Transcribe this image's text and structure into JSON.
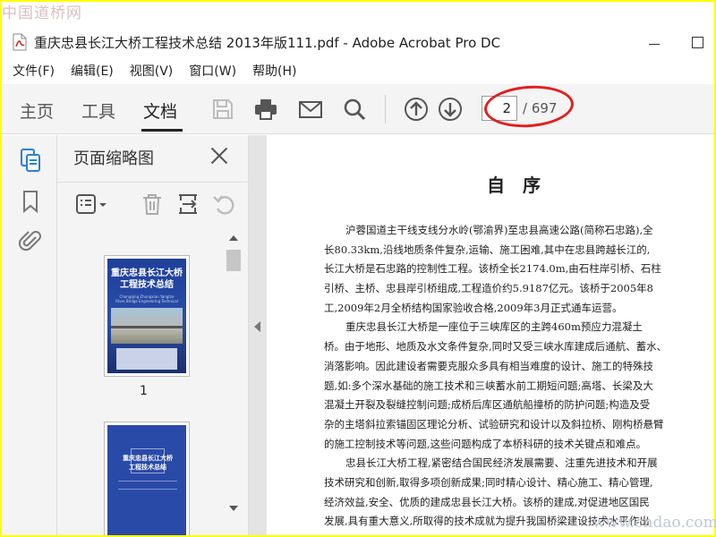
{
  "watermark": {
    "top_left": "中国道桥网",
    "bottom_right": "www.cndao.com"
  },
  "window": {
    "title": "重庆忠县长江大桥工程技术总结 2013年版111.pdf - Adobe Acrobat Pro DC"
  },
  "menu": [
    "文件(F)",
    "编辑(E)",
    "视图(V)",
    "窗口(W)",
    "帮助(H)"
  ],
  "toolbar": {
    "tabs": {
      "home": "主页",
      "tools": "工具",
      "document": "文档"
    },
    "active_tab": "文档",
    "icons": [
      "save-icon",
      "print-icon",
      "email-icon",
      "search-icon",
      "previous-page-icon",
      "next-page-icon"
    ],
    "page_current": "2",
    "page_total": "/ 697",
    "highlight_color": "#e02020"
  },
  "left_rail": {
    "icons": [
      "page-thumbnails-icon",
      "bookmark-icon",
      "attachment-icon"
    ]
  },
  "thumbnail_panel": {
    "title": "页面缩略图",
    "tools": [
      "options-menu-icon",
      "delete-page-icon",
      "extract-page-icon",
      "undo-icon"
    ],
    "thumbnails": [
      {
        "label": "1",
        "cover_title": "重庆忠县长江大桥\n工程技术总结",
        "cover_subtitle": "Chongqing Zhongxian Yangtze River Bridge Engineering Technical Summary"
      },
      {
        "label": "",
        "cover_title": "重庆忠县长江大桥\n工程技术总结"
      }
    ]
  },
  "document": {
    "heading": "自序",
    "lines": [
      {
        "text": "沪蓉国道主干线支线分水岭(鄂渝界)至忠县高速公路(简称石忠路),全",
        "indent": true
      },
      {
        "text": "长80.33km,沿线地质条件复杂,运输、施工困难,其中在忠县跨越长江的,",
        "indent": false
      },
      {
        "text": "长江大桥是石忠路的控制性工程。该桥全长2174.0m,由石柱岸引桥、石柱",
        "indent": false
      },
      {
        "text": "引桥、主桥、忠县岸引桥组成,工程造价约5.9187亿元。该桥于2005年8",
        "indent": false
      },
      {
        "text": "工,2009年2月全桥结构国家验收合格,2009年3月正式通车运营。",
        "indent": false
      },
      {
        "text": "重庆忠县长江大桥是一座位于三峡库区的主跨460m预应力混凝土",
        "indent": true
      },
      {
        "text": "桥。由于地形、地质及水文条件复杂,同时又受三峡水库建成后通航、蓄水、",
        "indent": false
      },
      {
        "text": "消落影响。因此建设者需要克服众多具有相当难度的设计、施工的特殊技",
        "indent": false
      },
      {
        "text": "题,如:多个深水基础的施工技术和三峡蓄水前工期短问题;高塔、长梁及大",
        "indent": false
      },
      {
        "text": "混凝土开裂及裂缝控制问题;成桥后库区通航船撞桥的防护问题;构造及受",
        "indent": false
      },
      {
        "text": "杂的主塔斜拉索锚固区理论分析、试验研究和设计以及斜拉桥、刚构桥悬臂",
        "indent": false
      },
      {
        "text": "的施工控制技术等问题,这些问题构成了本桥科研的技术关键点和难点。",
        "indent": false
      },
      {
        "text": "忠县长江大桥工程,紧密结合国民经济发展需要、注重先进技术和开展",
        "indent": true
      },
      {
        "text": "技术研究和创新,取得多项创新成果;同时精心设计、精心施工、精心管理,",
        "indent": false
      },
      {
        "text": "经济效益,安全、优质的建成忠县长江大桥。该桥的建成,对促进地区国民",
        "indent": false
      },
      {
        "text": "发展,具有重大意义,所取得的技术成就为提升我国桥梁建设技术水平作出",
        "indent": false
      }
    ]
  },
  "colors": {
    "frame_border": "#ffff00",
    "thumbnail_cover": "#2a4aa8"
  }
}
